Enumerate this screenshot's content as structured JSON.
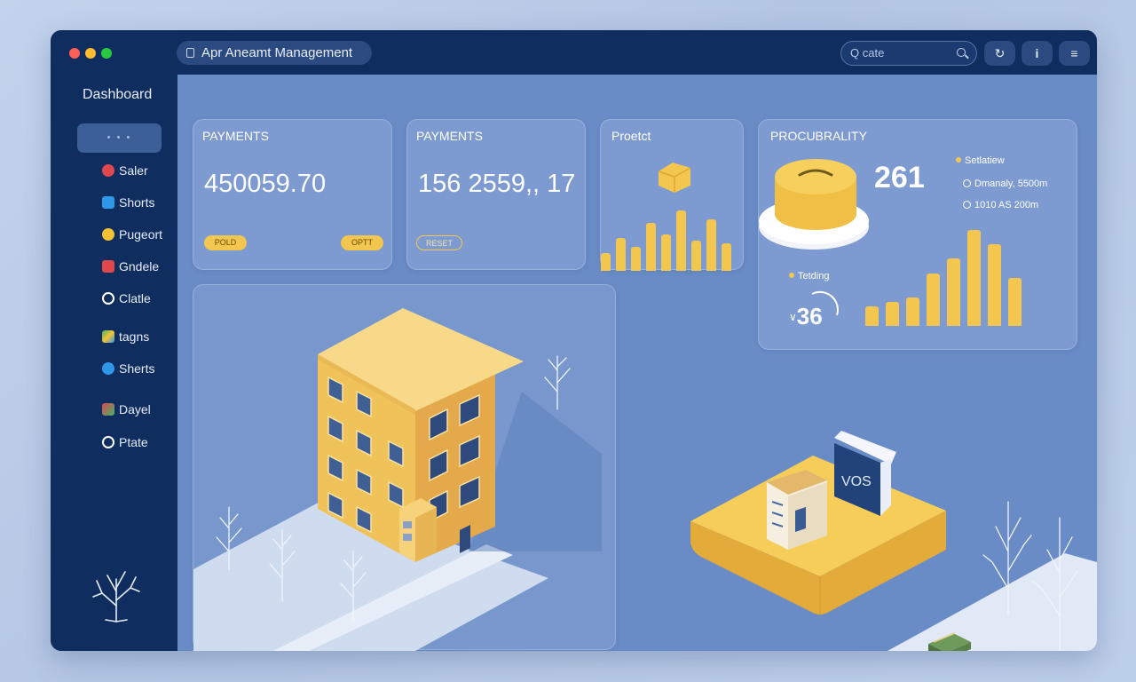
{
  "window": {
    "app_title": "Apr Aneamt Management",
    "search_placeholder": "Q cate",
    "toolbar_buttons": [
      "refresh-icon",
      "info-icon",
      "menu-icon"
    ],
    "traffic_lights": [
      "#ff5f57",
      "#febc2e",
      "#28c840"
    ]
  },
  "sidebar": {
    "title": "Dashboard",
    "active_item": "• • •",
    "items": [
      {
        "label": "Saler",
        "icon": "rocket-icon",
        "color": "#e0474c"
      },
      {
        "label": "Shorts",
        "icon": "app-icon",
        "color": "#2f97e8"
      },
      {
        "label": "Pugeort",
        "icon": "badge-icon",
        "color": "#f5c233"
      },
      {
        "label": "Gndele",
        "icon": "chart-icon",
        "color": "#e0474c"
      },
      {
        "label": "Clatle",
        "icon": "globe-icon",
        "color": "#ffffff"
      },
      {
        "label": "tagns",
        "icon": "palette-icon",
        "color": "#42b36b"
      },
      {
        "label": "Sherts",
        "icon": "facebook-icon",
        "color": "#2f97e8"
      },
      {
        "label": "Dayel",
        "icon": "cube-icon",
        "color": "#e0474c"
      },
      {
        "label": "Ptate",
        "icon": "pinterest-icon",
        "color": "#ffffff"
      }
    ]
  },
  "cards": {
    "payments1": {
      "title": "PAYMENTS",
      "value": "450059.70",
      "pill_left": "POLD",
      "pill_right": "OPTT"
    },
    "payments2": {
      "title": "PAYMENTS",
      "value": "156 2559,, 17",
      "pill": "RESET"
    },
    "project": {
      "title": "Proetct",
      "bars": [
        0.3,
        0.55,
        0.4,
        0.8,
        0.6,
        1.0,
        0.5,
        0.85,
        0.45
      ]
    },
    "procurability": {
      "title": "PROCUBRALITY",
      "value": "261",
      "legend": [
        "Setlatiew",
        "Dmanaly, 5500m",
        "1010 AS 200m"
      ],
      "sub_label": "Tetding",
      "sub_value": "36",
      "bars": [
        0.2,
        0.25,
        0.3,
        0.55,
        0.7,
        1.0,
        0.85,
        0.5
      ]
    }
  },
  "scene": {
    "sign_text": "VOS"
  },
  "colors": {
    "accent": "#f3c64f",
    "navy": "#102d5f",
    "panel": "#6a8cc6"
  }
}
